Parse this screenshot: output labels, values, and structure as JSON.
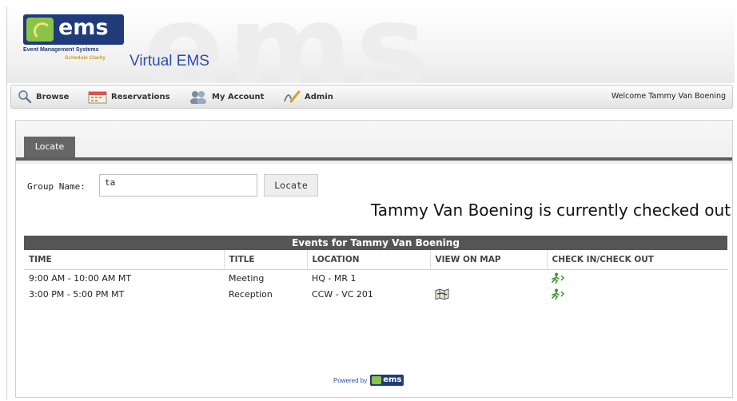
{
  "header": {
    "logo_word": "ems",
    "logo_subtitle": "Event Management Systems",
    "logo_tagline": "Schedule Clarity",
    "watermark": "ems",
    "app_name": "Virtual EMS"
  },
  "nav": {
    "items": [
      {
        "label": "Browse",
        "icon": "magnifier-icon"
      },
      {
        "label": "Reservations",
        "icon": "calendar-icon"
      },
      {
        "label": "My Account",
        "icon": "people-icon"
      },
      {
        "label": "Admin",
        "icon": "pen-icon"
      }
    ],
    "welcome": "Welcome Tammy Van Boening"
  },
  "tabs": [
    {
      "label": "Locate",
      "active": true
    }
  ],
  "form": {
    "group_name_label": "Group Name:",
    "group_name_value": "ta",
    "locate_button": "Locate"
  },
  "status_message": "Tammy Van Boening is currently checked out",
  "events": {
    "title": "Events for Tammy Van Boening",
    "columns": [
      "TIME",
      "TITLE",
      "LOCATION",
      "VIEW ON MAP",
      "CHECK IN/CHECK OUT"
    ],
    "rows": [
      {
        "time": "9:00 AM - 10:00 AM MT",
        "title": "Meeting",
        "location": "HQ - MR 1",
        "map": false,
        "checkin": true
      },
      {
        "time": "3:00 PM - 5:00 PM MT",
        "title": "Reception",
        "location": "CCW - VC 201",
        "map": true,
        "checkin": true
      }
    ]
  },
  "footer": {
    "powered_by": "Powered by",
    "logo_word": "ems"
  },
  "colors": {
    "brand_blue": "#1f3b7a",
    "brand_green": "#8bc34a",
    "tab_gray": "#666666",
    "link_blue": "#2a4fb0"
  }
}
